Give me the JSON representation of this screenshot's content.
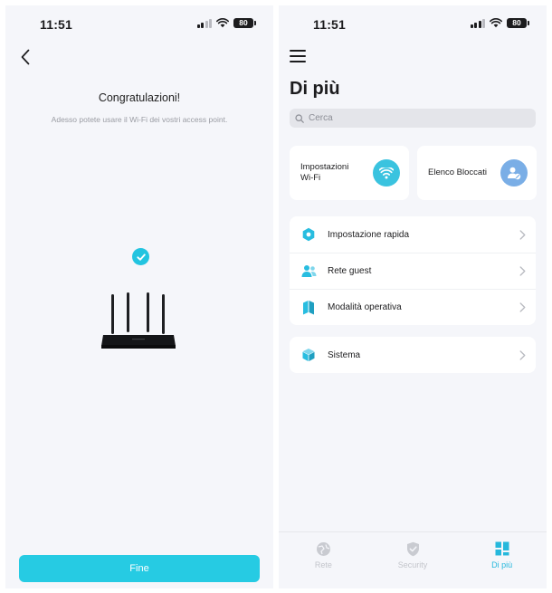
{
  "left_screen": {
    "status_bar": {
      "time": "11:51",
      "battery": "80"
    },
    "title": "Congratulazioni!",
    "subtitle": "Adesso potete usare il Wi-Fi dei vostri access point.",
    "done_button": "Fine",
    "accent_color": "#26cbe3"
  },
  "right_screen": {
    "status_bar": {
      "time": "11:51",
      "battery": "80"
    },
    "page_title": "Di più",
    "search": {
      "placeholder": "Cerca"
    },
    "cards": [
      {
        "label": "Impostazioni\nWi-Fi",
        "icon": "wifi-icon",
        "color": "#3ac3df"
      },
      {
        "label": "Elenco Bloccati",
        "icon": "blocked-user-icon",
        "color": "#7aaee6"
      }
    ],
    "menu_items": [
      {
        "label": "Impostazione rapida",
        "icon": "quick-setup-icon"
      },
      {
        "label": "Rete guest",
        "icon": "guest-network-icon"
      },
      {
        "label": "Modalità operativa",
        "icon": "operation-mode-icon"
      }
    ],
    "system_item": {
      "label": "Sistema",
      "icon": "system-cube-icon"
    },
    "tabs": [
      {
        "label": "Rete",
        "icon": "network-globe-icon",
        "active": false
      },
      {
        "label": "Security",
        "icon": "shield-icon",
        "active": false
      },
      {
        "label": "Di più",
        "icon": "grid-icon",
        "active": true
      }
    ],
    "accent_color": "#26b8dc"
  }
}
